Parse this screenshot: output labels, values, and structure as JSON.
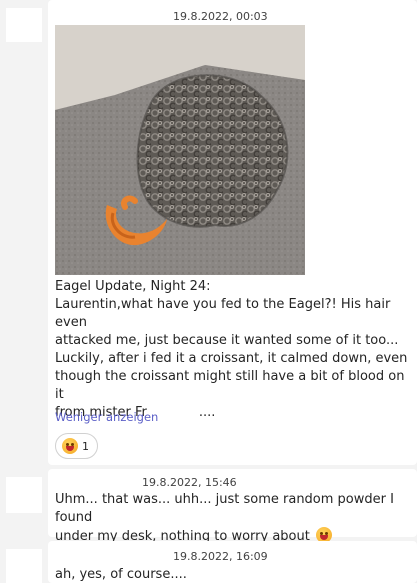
{
  "messages": [
    {
      "timestamp": "19.8.2022, 00:03",
      "image_alt": "Photo of a grey curly wig lying on grey carpet next to a plush croissant toy",
      "lines": [
        "Eagel Update, Night 24:",
        "Laurentin,what have you fed to the Eagel?! His hair even",
        "attacked me, just because it wanted some of it too...",
        "Luckily, after i fed it a croissant, it calmed down, even",
        "though the croissant might still have a bit of blood on it"
      ],
      "last_line_prefix": "from mister Fr",
      "last_line_suffix": "....",
      "show_less_label": "Weniger anzeigen",
      "reaction": {
        "emoji": "grinning-squinting-face",
        "count": "1"
      }
    },
    {
      "timestamp": "19.8.2022, 15:46",
      "lines": [
        "Uhm... that was... uhh... just some random powder I found",
        "under my desk, nothing to worry about"
      ]
    },
    {
      "timestamp": "19.8.2022, 16:09",
      "lines": [
        "ah, yes, of course...."
      ]
    }
  ],
  "colors": {
    "background": "#f3f3f3",
    "bubble": "#ffffff",
    "link": "#5b5fc7",
    "text": "#242424"
  }
}
